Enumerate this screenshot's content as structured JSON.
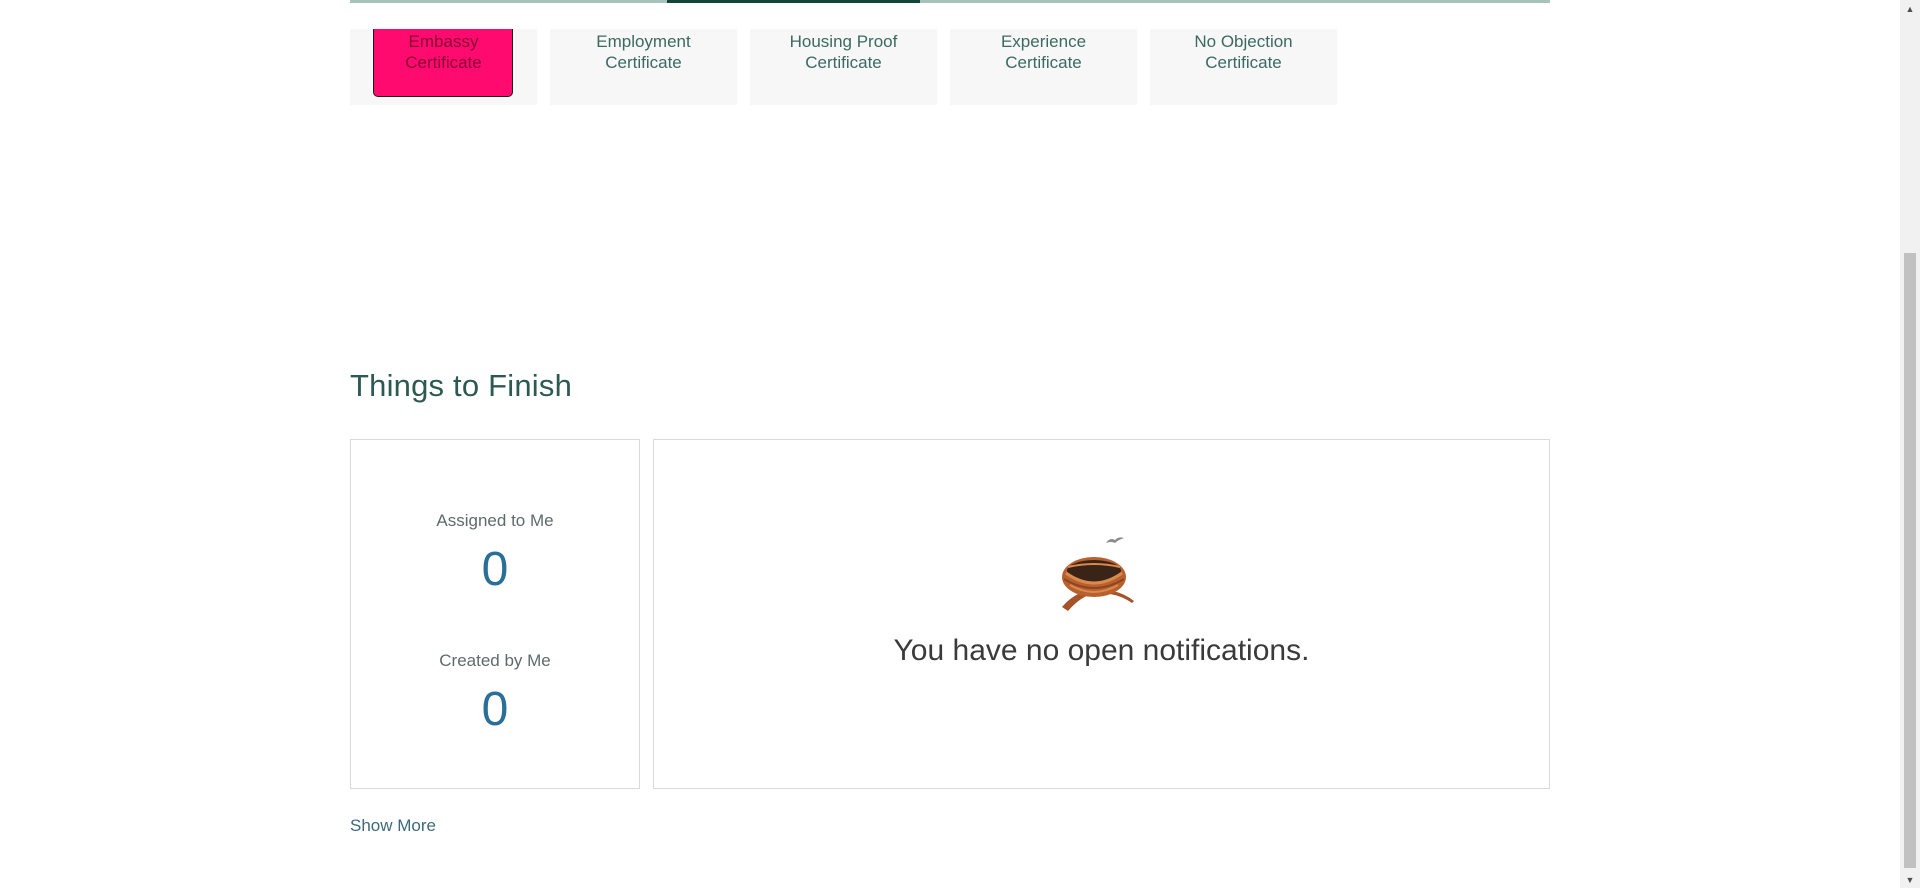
{
  "tiles": [
    {
      "label": "Embassy Certificate",
      "selected": true
    },
    {
      "label": "Employment Certificate",
      "selected": false
    },
    {
      "label": "Housing Proof Certificate",
      "selected": false
    },
    {
      "label": "Experience Certificate",
      "selected": false
    },
    {
      "label": "No Objection Certificate",
      "selected": false
    }
  ],
  "things_to_finish": {
    "title": "Things to Finish",
    "assigned_label": "Assigned to Me",
    "assigned_count": "0",
    "created_label": "Created by Me",
    "created_count": "0",
    "empty_message": "You have no open notifications.",
    "empty_icon": "bird-nest-icon",
    "show_more": "Show More"
  },
  "colors": {
    "accent": "#13463a",
    "selected_tile": "#ff0a6e",
    "count": "#2a6f97",
    "heading": "#2d5a50"
  }
}
